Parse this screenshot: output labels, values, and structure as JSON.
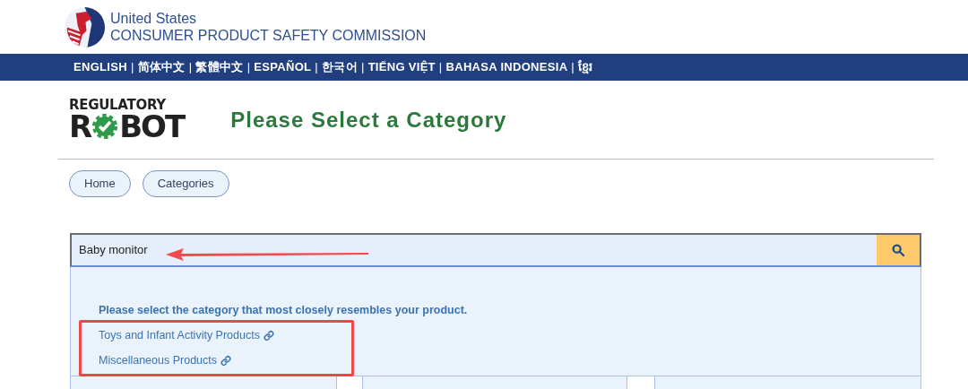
{
  "header": {
    "agency_line1": "United States",
    "agency_line2": "CONSUMER PRODUCT SAFETY COMMISSION"
  },
  "language_bar": {
    "separator": "|",
    "languages": [
      "ENGLISH",
      "简体中文",
      "繁體中文",
      "ESPAÑOL",
      "한국어",
      "TIẾNG VIỆT",
      "BAHASA INDONESIA",
      "ខ្មែរ"
    ]
  },
  "logo": {
    "line1": "REGULATORY",
    "line2_start": "R",
    "line2_end": "BOT"
  },
  "page_title": "Please Select a Category",
  "breadcrumbs": [
    "Home",
    "Categories"
  ],
  "search": {
    "value": "Baby monitor"
  },
  "results": {
    "prompt": "Please select the category that most closely resembles your product.",
    "links": [
      "Toys and Infant Activity Products",
      "Miscellaneous Products"
    ]
  }
}
